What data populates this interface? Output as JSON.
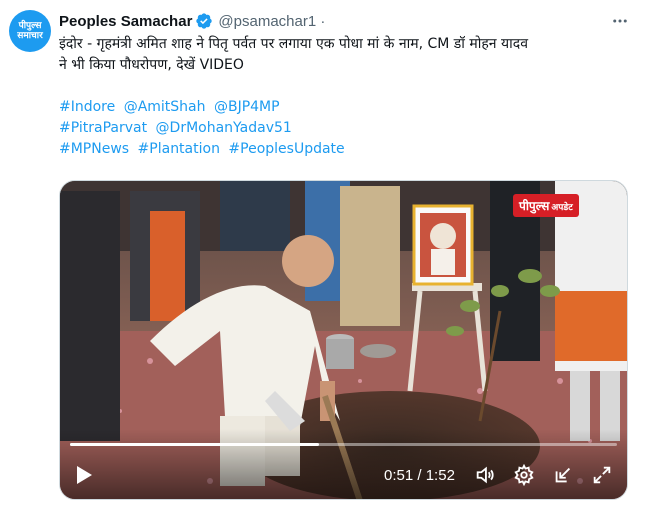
{
  "account": {
    "avatar_line1": "पीपुल्स",
    "avatar_line2": "समाचार",
    "name": "Peoples Samachar",
    "handle": "@psamachar1",
    "handle_suffix": " ·",
    "verified_color": "#1d9bf0"
  },
  "tweet": {
    "line1": "इंदोर - गृहमंत्री अमित शाह  ने पितृ पर्वत पर लगाया एक पोधा मां के नाम, CM डॉ मोहन यादव",
    "line2": "ने भी किया पौधरोपण, देखें VIDEO",
    "hashtags": [
      [
        "#Indore",
        "@AmitShah",
        "@BJP4MP"
      ],
      [
        "#PitraParvat",
        "@DrMohanYadav51"
      ],
      [
        "#MPNews",
        "#Plantation",
        "#PeoplesUpdate"
      ]
    ]
  },
  "video": {
    "badge_main": "पीपुल्स",
    "badge_sub": "अपडेट",
    "time_current": "0:51",
    "time_separator": " / ",
    "time_total": "1:52",
    "progress_fraction": 0.455
  },
  "icons": {
    "more": "more-options-icon",
    "verified": "verified-badge-icon",
    "play": "play-icon",
    "volume": "volume-icon",
    "settings": "gear-icon",
    "minimize": "minimize-icon",
    "fullscreen": "fullscreen-icon"
  },
  "colors": {
    "link": "#1d9bf0",
    "text": "#0f1419",
    "muted": "#536471",
    "badge": "#d61f26"
  }
}
